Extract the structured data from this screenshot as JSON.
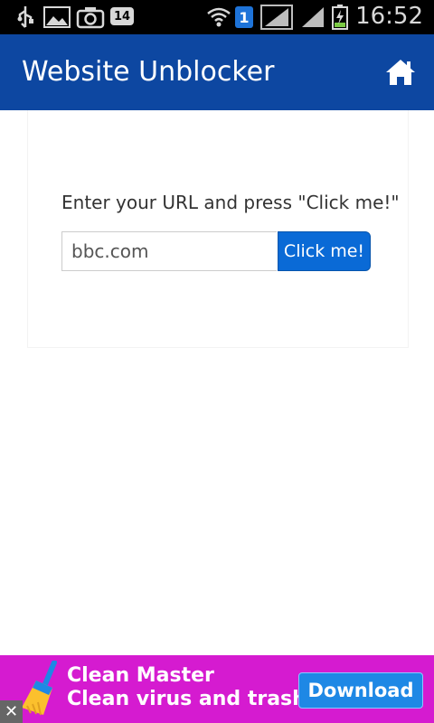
{
  "status_bar": {
    "notification_badge": "14",
    "sim_label": "1",
    "time": "16:52",
    "icons": [
      "usb-icon",
      "image-icon",
      "camera-icon",
      "calendar-badge-icon",
      "wifi-icon",
      "sim-icon",
      "signal-icon",
      "signal-icon",
      "battery-charging-icon"
    ]
  },
  "app_bar": {
    "title": "Website Unblocker",
    "home_icon": "home-icon",
    "color": "#0d47a1"
  },
  "main": {
    "prompt": "Enter your URL and press \"Click me!\"",
    "url_value": "bbc.com",
    "button_label": "Click me!",
    "button_color": "#0a6ad6"
  },
  "ad": {
    "line1": "Clean Master",
    "line2": "Clean virus and trash!",
    "download_label": "Download",
    "close_glyph": "✕",
    "background": "#d51bd0"
  }
}
